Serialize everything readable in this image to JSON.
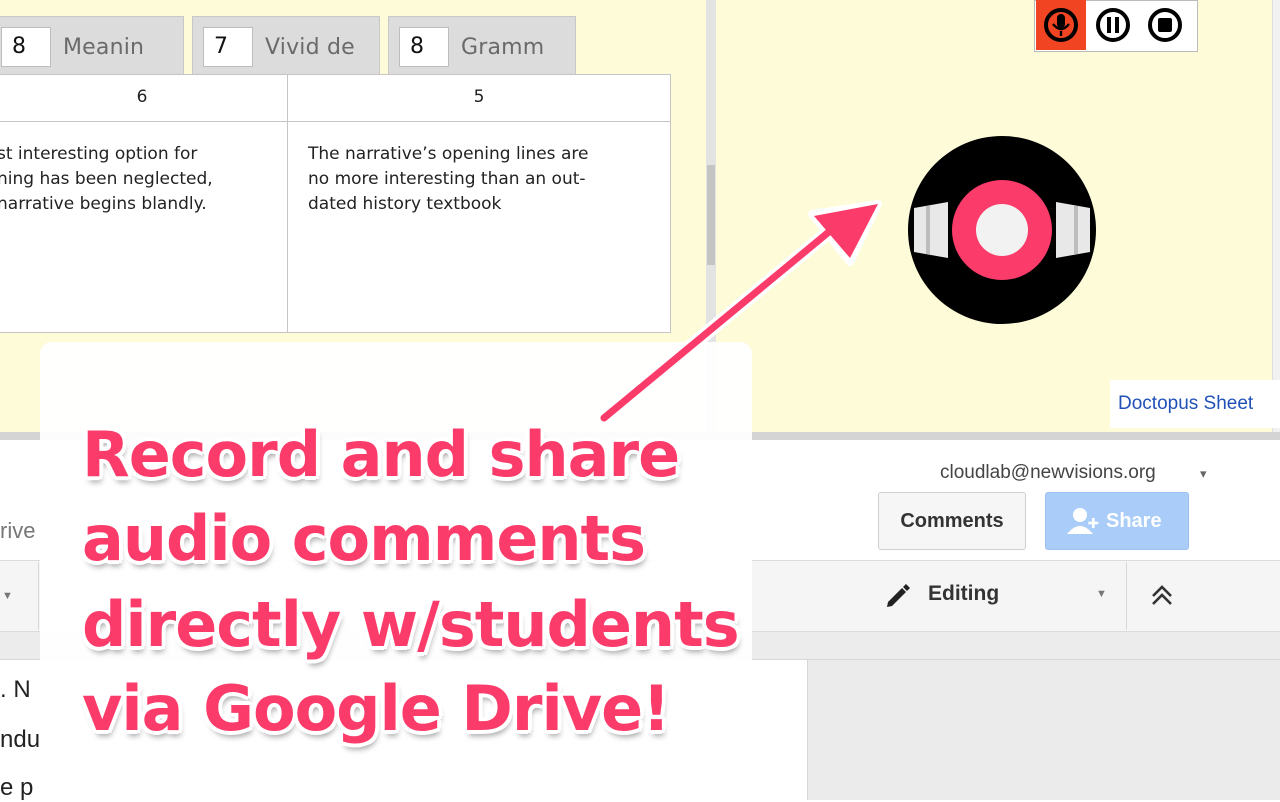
{
  "rubric": {
    "tabs": [
      {
        "score": "8",
        "label": "Meanin"
      },
      {
        "score": "7",
        "label": "Vivid de"
      },
      {
        "score": "8",
        "label": "Gramm"
      }
    ],
    "columns": [
      {
        "level": "6",
        "description_lines": [
          "st interesting option for",
          "ning has been neglected,",
          "narrative begins blandly."
        ]
      },
      {
        "level": "5",
        "description_lines": [
          "The narrative’s opening lines are",
          "no more interesting than an out-",
          "dated history textbook"
        ]
      }
    ]
  },
  "recorder": {
    "record_icon": "microphone-icon",
    "pause_icon": "pause-icon",
    "stop_icon": "stop-icon",
    "record_color": "#f04423"
  },
  "sidebar": {
    "footer_link": "Doctopus Sheet"
  },
  "docs": {
    "account": "cloudlab@newvisions.org",
    "comments_label": "Comments",
    "share_label": "Share",
    "editing_label": "Editing",
    "drive_fragment": "rive",
    "text_fragments": [
      ". N",
      "ndu",
      "e p"
    ]
  },
  "callout": {
    "lines": [
      "Record and share",
      "audio comments",
      "directly w/students",
      "via Google Drive!"
    ],
    "color": "#fb3b6a"
  }
}
